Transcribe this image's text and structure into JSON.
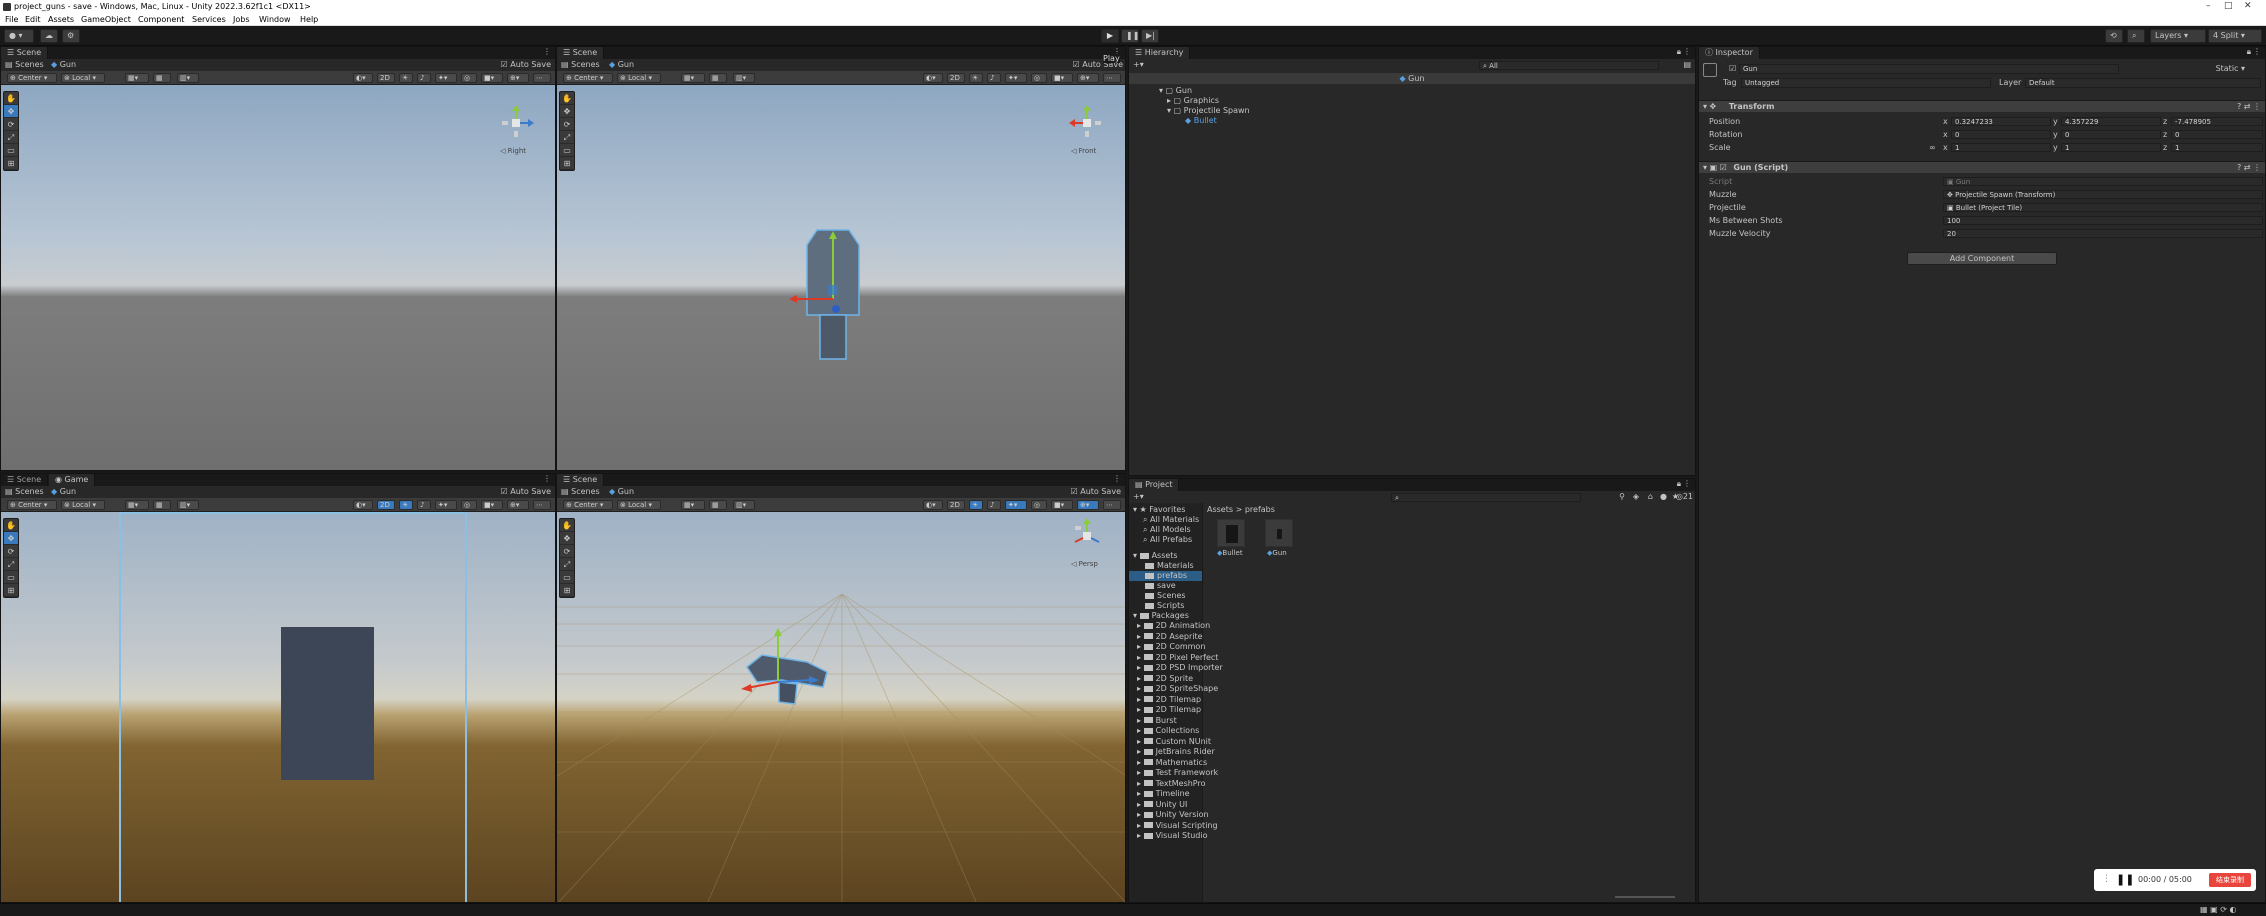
{
  "titlebar": {
    "title": "project_guns - save - Windows, Mac, Linux - Unity 2022.3.62f1c1 <DX11>"
  },
  "menu": [
    "File",
    "Edit",
    "Assets",
    "GameObject",
    "Component",
    "Services",
    "Jobs",
    "Window",
    "Help"
  ],
  "toolbar": {
    "play_tooltip": "Play",
    "layers": "Layers",
    "layout": "4 Split"
  },
  "scene1": {
    "tab": "Scene",
    "breadcrumb_scenes": "Scenes",
    "breadcrumb_obj": "Gun",
    "auto_save": "Auto Save",
    "pivot": "Center",
    "space": "Local",
    "mode2d": "2D",
    "gizmo_label": "◁ Right"
  },
  "scene2": {
    "tab": "Scene",
    "breadcrumb_scenes": "Scenes",
    "breadcrumb_obj": "Gun",
    "auto_save": "Auto Save",
    "pivot": "Center",
    "space": "Local",
    "mode2d": "2D",
    "gizmo_label": "◁ Front"
  },
  "scene3": {
    "tab": "Scene",
    "tab2": "Game",
    "breadcrumb_scenes": "Scenes",
    "breadcrumb_obj": "Gun",
    "auto_save": "Auto Save",
    "pivot": "Center",
    "space": "Local",
    "mode2d": "2D"
  },
  "scene4": {
    "tab": "Scene",
    "breadcrumb_scenes": "Scenes",
    "breadcrumb_obj": "Gun",
    "auto_save": "Auto Save",
    "pivot": "Center",
    "space": "Local",
    "mode2d": "2D",
    "gizmo_label": "◁ Persp"
  },
  "hierarchy": {
    "tab": "Hierarchy",
    "search_placeholder": "All",
    "context": "Gun",
    "items": [
      "Gun",
      "Graphics",
      "Projectile Spawn",
      "Bullet"
    ]
  },
  "project": {
    "tab": "Project",
    "search_count": "21",
    "favorites": "Favorites",
    "fav_items": [
      "All Materials",
      "All Models",
      "All Prefabs"
    ],
    "assets": "Assets",
    "asset_folders": [
      "Materials",
      "prefabs",
      "save",
      "Scenes",
      "Scripts"
    ],
    "packages": "Packages",
    "package_folders": [
      "2D Animation",
      "2D Aseprite",
      "2D Common",
      "2D Pixel Perfect",
      "2D PSD Importer",
      "2D Sprite",
      "2D SpriteShape",
      "2D Tilemap",
      "2D Tilemap",
      "Burst",
      "Collections",
      "Custom NUnit",
      "JetBrains Rider",
      "Mathematics",
      "Test Framework",
      "TextMeshPro",
      "Timeline",
      "Unity UI",
      "Unity Version",
      "Visual Scripting",
      "Visual Studio"
    ],
    "breadcrumb_root": "Assets",
    "breadcrumb_sep": ">",
    "breadcrumb_leaf": "prefabs",
    "items": [
      "Bullet",
      "Gun"
    ]
  },
  "inspector": {
    "tab": "Inspector",
    "name": "Gun",
    "static": "Static",
    "tag_label": "Tag",
    "tag": "Untagged",
    "layer_label": "Layer",
    "layer": "Default",
    "transform": {
      "title": "Transform",
      "position_label": "Position",
      "rotation_label": "Rotation",
      "scale_label": "Scale",
      "position": {
        "x": "0.3247233",
        "y": "4.357229",
        "z": "-7.478905"
      },
      "rotation": {
        "x": "0",
        "y": "0",
        "z": "0"
      },
      "scale": {
        "x": "1",
        "y": "1",
        "z": "1"
      }
    },
    "script": {
      "title": "Gun (Script)",
      "script_label": "Script",
      "script_value": "Gun",
      "muzzle_label": "Muzzle",
      "muzzle_value": "Projectile Spawn (Transform)",
      "projectile_label": "Projectile",
      "projectile_value": "Bullet (Project Tile)",
      "ms_label": "Ms Between Shots",
      "ms_value": "100",
      "vel_label": "Muzzle Velocity",
      "vel_value": "20"
    },
    "add_component": "Add Component"
  },
  "recorder": {
    "time": "00:00 / 05:00",
    "stop_label": "结束录制"
  },
  "axis": {
    "x": "x",
    "y": "y",
    "z": "z"
  },
  "colors": {
    "accent": "#3a79bb",
    "record": "#e8463c",
    "x_axis": "#db3b26",
    "y_axis": "#8bcc3a",
    "z_axis": "#3b7bcc"
  }
}
